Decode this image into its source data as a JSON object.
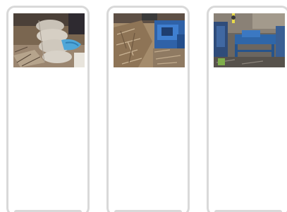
{
  "cards": [
    {
      "image": "photo-sacks-on-ground-icon"
    },
    {
      "image": "photo-wood-shavings-machine-icon"
    },
    {
      "image": "photo-workshop-machinery-icon"
    }
  ],
  "colors": {
    "card_border": "#d9d9d9",
    "card_background": "#ffffff"
  }
}
